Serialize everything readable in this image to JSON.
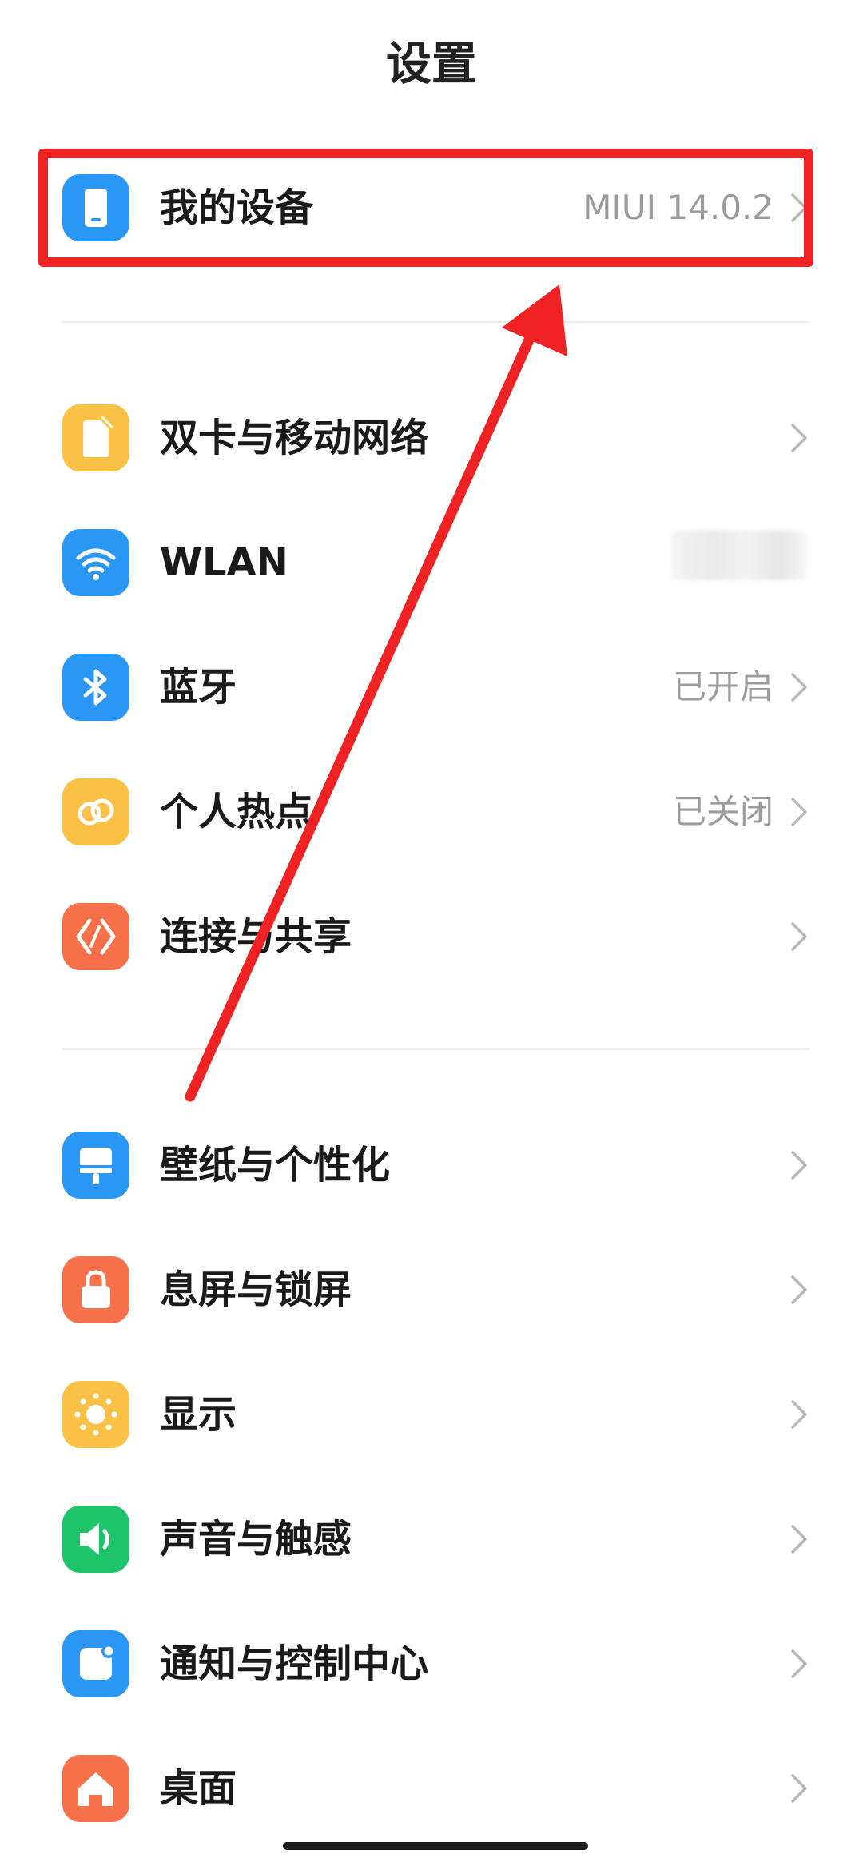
{
  "header": {
    "title": "设置"
  },
  "rows": [
    {
      "label": "我的设备",
      "value": "MIUI 14.0.2",
      "icon": "phone-icon",
      "color": "#2a97f4"
    },
    {
      "label": "双卡与移动网络",
      "value": "",
      "icon": "sim-card-icon",
      "color": "#fbc046"
    },
    {
      "label": "WLAN",
      "value": "",
      "icon": "wifi-icon",
      "color": "#2a97f4"
    },
    {
      "label": "蓝牙",
      "value": "已开启",
      "icon": "bluetooth-icon",
      "color": "#2a97f4"
    },
    {
      "label": "个人热点",
      "value": "已关闭",
      "icon": "hotspot-icon",
      "color": "#fbc046"
    },
    {
      "label": "连接与共享",
      "value": "",
      "icon": "connection-share-icon",
      "color": "#f6714a"
    },
    {
      "label": "壁纸与个性化",
      "value": "",
      "icon": "wallpaper-brush-icon",
      "color": "#2a97f4"
    },
    {
      "label": "息屏与锁屏",
      "value": "",
      "icon": "lock-icon",
      "color": "#f6714a"
    },
    {
      "label": "显示",
      "value": "",
      "icon": "sun-icon",
      "color": "#fbc046"
    },
    {
      "label": "声音与触感",
      "value": "",
      "icon": "speaker-icon",
      "color": "#1ec46a"
    },
    {
      "label": "通知与控制中心",
      "value": "",
      "icon": "notification-icon",
      "color": "#2a97f4"
    },
    {
      "label": "桌面",
      "value": "",
      "icon": "home-icon",
      "color": "#f6714a"
    }
  ],
  "annotation": {
    "color": "#ee2222"
  }
}
